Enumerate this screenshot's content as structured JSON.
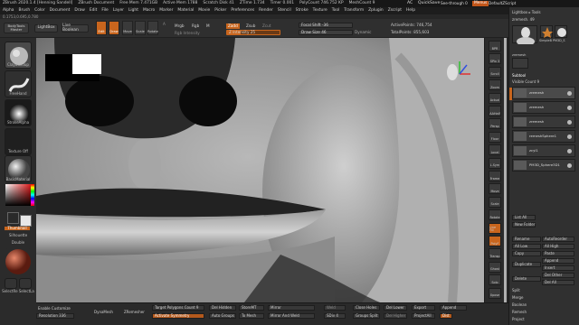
{
  "titlebar": {
    "app": "ZBrush 2020.1.4 [Henning Sandell]",
    "document": "ZBrush Document",
    "free_mem": "Free Mem 7.471GB",
    "active_mem": "Active Mem 1788",
    "scratch": "Scratch Disk 41",
    "ztime": "ZTime 1.734",
    "timer": "Timer 0.001",
    "polycount": "PolyCount 746.752 KP",
    "meshcount": "MeshCount 9",
    "ac_label": "AC",
    "quicksave_label": "QuickSave",
    "seethrough_label": "See-through 0",
    "menus_label": "Menus",
    "script_label": "DefaultZScript"
  },
  "menubar": [
    "Alpha",
    "Brush",
    "Color",
    "Document",
    "Draw",
    "Edit",
    "File",
    "Layer",
    "Light",
    "Macro",
    "Marker",
    "Material",
    "Movie",
    "Picker",
    "Preferences",
    "Render",
    "Stencil",
    "Stroke",
    "Texture",
    "Tool",
    "Transform",
    "Zplugin",
    "Zscript",
    "Help"
  ],
  "coords": "0.1753,0.695,0.780",
  "shelf": {
    "projection_master": "BodyTools Master",
    "lightbox": "LightBox",
    "live_boolean": "Live Boolean",
    "edit": "Edit",
    "draw": "Draw",
    "move": "Move",
    "scale": "Scale",
    "rotate": "Rotate",
    "a_label": "A",
    "mrgb": "Mrgb",
    "rgb": "Rgb",
    "m_label": "M",
    "rgb_intensity": "Rgb Intensity",
    "zadd": "Zadd",
    "zsub": "Zsub",
    "zcut": "Zcut",
    "z_intensity": "Z Intensity 25",
    "z_intensity_value": 0.25,
    "focal_shift": "Focal Shift -36",
    "draw_size": "Draw Size 46",
    "dynamic": "Dynamic",
    "active_points": "ActivePoints: 746,754",
    "total_points": "TotalPoints: 855,603"
  },
  "leftbar": {
    "brush": "ClayBuildup",
    "stroke": "FreeHand",
    "alpha": "StrokeAlpha",
    "texture": "Texture Off",
    "material": "BasicMaterial",
    "gradient": "Gradient",
    "switch_color": "SwitchColor",
    "alternate": "Alternate",
    "secondary": "Thumbnail",
    "silhouette": "Silhouette",
    "double": "Double",
    "selectrect": "SelectRe SelectLa",
    "color_primary": "#2a2a2a",
    "color_secondary": "#e8e8e8"
  },
  "rightstrip": [
    "BPR",
    "SPix 3",
    "Scroll",
    "Zoom",
    "Actual",
    "AAHalf",
    "Persp",
    "Floor",
    "Local",
    "L.Sym",
    "Frame",
    "Move",
    "Scale",
    "Rotate",
    "Line Fill",
    "PolyF",
    "Transp",
    "Ghost",
    "Solo",
    "Xpose"
  ],
  "rightpanel": {
    "header": "Lightbox ▸ Tools",
    "tool_name": "zremesh. 49",
    "load_tool": "Load Tool",
    "copy_tool": "Copy Tool",
    "import": "Import",
    "export": "Export",
    "clone": "Clone",
    "make_polymesh": "Make PolyMesh3D",
    "goz": "GoZ",
    "all": "All",
    "visible": "Visible",
    "r_label": "R",
    "thumb_a": "zremesh",
    "thumb_b": "PolyMesh",
    "thumb_c": "SimpleB PM3D_S",
    "thumb_d": "zremesh",
    "subtool": "Subtool",
    "visible_count": "Visible Count 9",
    "subtool_items": [
      "zremesh",
      "zremesh",
      "zremesh",
      "remeshSphere1",
      "zcyl1",
      "PM3D_Sphere3D1"
    ],
    "list_all": "List All",
    "new_folder": "New Folder",
    "rename": "Rename",
    "autoreorder": "AutoReorder",
    "all_low": "All Low",
    "all_high": "All High",
    "copy": "Copy",
    "paste": "Paste",
    "append": "Append",
    "duplicate": "Duplicate",
    "insert": "Insert",
    "del_other": "Del Other",
    "delete": "Delete",
    "del_all": "Del All",
    "split": "Split",
    "merge": "Merge",
    "boolean": "Boolean",
    "remesh": "Remesh",
    "project": "Project"
  },
  "bottombar": {
    "enable_customize": "Enable Customize",
    "resolution": "Resolution 336",
    "dynamesh": "DynaMesh",
    "zremesher": "ZRemesher",
    "target_poly": "Target Polygons Count 9",
    "activate_symmetry": "Activate Symmetry",
    "del_hidden": "Del Hidden",
    "auto_groups": "Auto Groups",
    "store_mt": "StoreMT",
    "to_mesh": "To Mesh",
    "mirror": "Mirror",
    "mirror_weld": "Mirror And Weld",
    "weld": "Weld",
    "close_holes": "Close Holes",
    "groups_split": "Groups Split",
    "del_lower": "Del Lower",
    "del_higher": "Del Higher",
    "export": "Export",
    "project_all": "ProjectAll",
    "append": "Append",
    "sdiv": "SDiv 4",
    "dist": "Dist"
  },
  "colors": {
    "accent": "#c8651d",
    "panel": "#303030",
    "bg": "#272727"
  }
}
